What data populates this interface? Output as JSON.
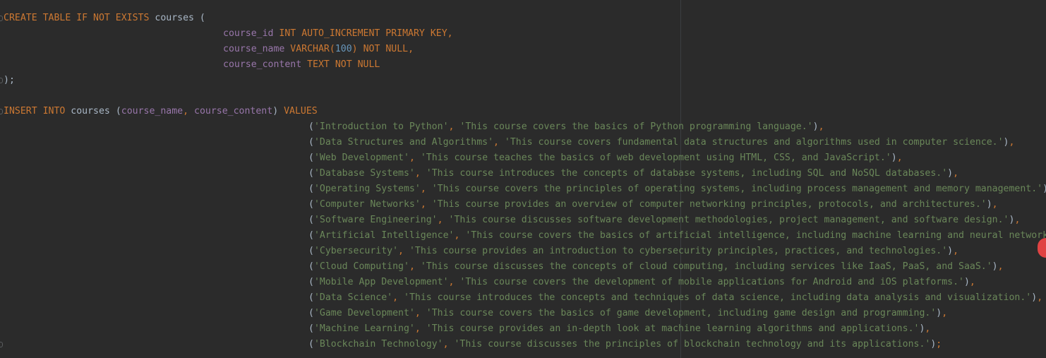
{
  "editor": {
    "create_table": {
      "keywords": "CREATE TABLE IF NOT EXISTS",
      "table": "courses",
      "open": "(",
      "close": ");",
      "columns": [
        {
          "name": "course_id",
          "type": "INT",
          "num": "",
          "type_close": "",
          "constraints": "AUTO_INCREMENT PRIMARY KEY",
          "comma": ","
        },
        {
          "name": "course_name",
          "type": "VARCHAR(",
          "num": "100",
          "type_close": ")",
          "constraints": "NOT NULL",
          "comma": ","
        },
        {
          "name": "course_content",
          "type": "TEXT",
          "num": "",
          "type_close": "",
          "constraints": "NOT NULL",
          "comma": ""
        }
      ]
    },
    "insert": {
      "keyword_insert": "INSERT INTO",
      "table": "courses",
      "col1": "course_name",
      "col2": "course_content",
      "values_kw": "VALUES",
      "rows": [
        {
          "name": "'Introduction to Python'",
          "content": "'This course covers the basics of Python programming language.'",
          "end": ","
        },
        {
          "name": "'Data Structures and Algorithms'",
          "content": "'This course covers fundamental data structures and algorithms used in computer science.'",
          "end": ","
        },
        {
          "name": "'Web Development'",
          "content": "'This course teaches the basics of web development using HTML, CSS, and JavaScript.'",
          "end": ","
        },
        {
          "name": "'Database Systems'",
          "content": "'This course introduces the concepts of database systems, including SQL and NoSQL databases.'",
          "end": ","
        },
        {
          "name": "'Operating Systems'",
          "content": "'This course covers the principles of operating systems, including process management and memory management.'",
          "end": ","
        },
        {
          "name": "'Computer Networks'",
          "content": "'This course provides an overview of computer networking principles, protocols, and architectures.'",
          "end": ","
        },
        {
          "name": "'Software Engineering'",
          "content": "'This course discusses software development methodologies, project management, and software design.'",
          "end": ","
        },
        {
          "name": "'Artificial Intelligence'",
          "content": "'This course covers the basics of artificial intelligence, including machine learning and neural networks.'",
          "end": ","
        },
        {
          "name": "'Cybersecurity'",
          "content": "'This course provides an introduction to cybersecurity principles, practices, and technologies.'",
          "end": ","
        },
        {
          "name": "'Cloud Computing'",
          "content": "'This course discusses the concepts of cloud computing, including services like IaaS, PaaS, and SaaS.'",
          "end": ","
        },
        {
          "name": "'Mobile App Development'",
          "content": "'This course covers the development of mobile applications for Android and iOS platforms.'",
          "end": ","
        },
        {
          "name": "'Data Science'",
          "content": "'This course introduces the concepts and techniques of data science, including data analysis and visualization.'",
          "end": ","
        },
        {
          "name": "'Game Development'",
          "content": "'This course covers the basics of game development, including game design and programming.'",
          "end": ","
        },
        {
          "name": "'Machine Learning'",
          "content": "'This course provides an in-depth look at machine learning algorithms and applications.'",
          "end": ","
        },
        {
          "name": "'Blockchain Technology'",
          "content": "'This course discusses the principles of blockchain technology and its applications.'",
          "end": ";"
        }
      ]
    }
  },
  "colors": {
    "background": "#2b2b2b",
    "keyword": "#cc7832",
    "column": "#9876aa",
    "string": "#6a8759",
    "number": "#6897bb",
    "identifier": "#a9b7c6"
  }
}
